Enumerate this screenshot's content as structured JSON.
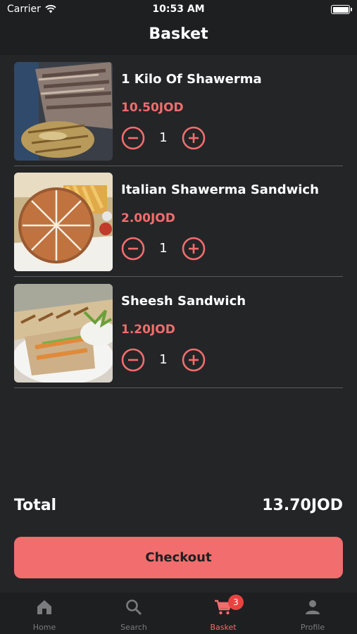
{
  "status_bar": {
    "carrier": "Carrier",
    "time": "10:53 AM"
  },
  "header": {
    "title": "Basket"
  },
  "items": [
    {
      "name": "1 Kilo Of Shawerma",
      "price": "10.50JOD",
      "quantity": "1"
    },
    {
      "name": "Italian Shawerma Sandwich",
      "price": "2.00JOD",
      "quantity": "1"
    },
    {
      "name": "Sheesh Sandwich",
      "price": "1.20JOD",
      "quantity": "1"
    }
  ],
  "summary": {
    "total_label": "Total",
    "total_value": "13.70JOD"
  },
  "checkout": {
    "label": "Checkout"
  },
  "tabs": [
    {
      "label": "Home",
      "icon": "home-icon"
    },
    {
      "label": "Search",
      "icon": "search-icon"
    },
    {
      "label": "Basket",
      "icon": "cart-icon",
      "badge": "3"
    },
    {
      "label": "Profile",
      "icon": "person-icon"
    }
  ],
  "colors": {
    "accent": "#f26d6d",
    "background": "#242527",
    "bar": "#1e1f21",
    "badge": "#e8433f",
    "inactive": "#7a7b7e"
  }
}
